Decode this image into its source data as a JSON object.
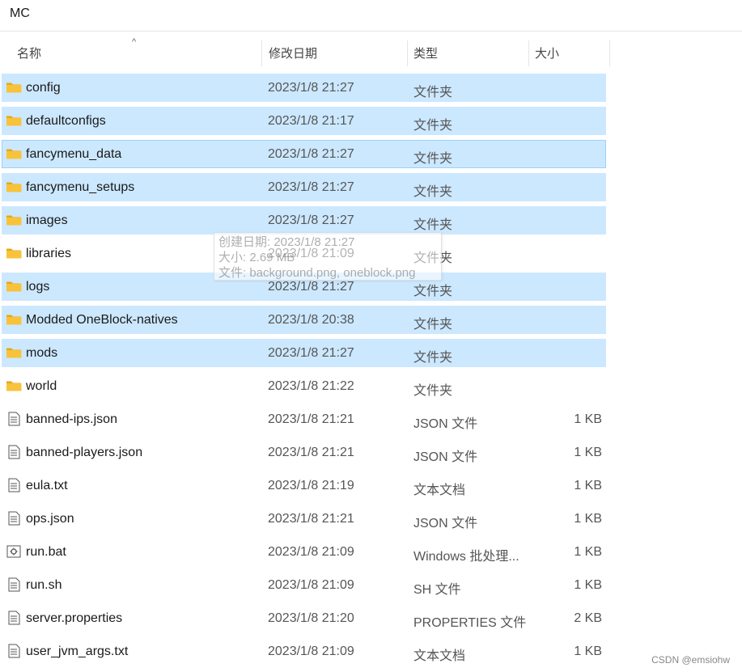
{
  "breadcrumb": {
    "title": "MC"
  },
  "columns": {
    "name": "名称",
    "date": "修改日期",
    "type": "类型",
    "size": "大小"
  },
  "rows": [
    {
      "name": "config",
      "date": "2023/1/8 21:27",
      "type": "文件夹",
      "size": "",
      "kind": "folder",
      "selected": true
    },
    {
      "name": "defaultconfigs",
      "date": "2023/1/8 21:17",
      "type": "文件夹",
      "size": "",
      "kind": "folder",
      "selected": true
    },
    {
      "name": "fancymenu_data",
      "date": "2023/1/8 21:27",
      "type": "文件夹",
      "size": "",
      "kind": "folder",
      "selected": true,
      "focused": true
    },
    {
      "name": "fancymenu_setups",
      "date": "2023/1/8 21:27",
      "type": "文件夹",
      "size": "",
      "kind": "folder",
      "selected": true
    },
    {
      "name": "images",
      "date": "2023/1/8 21:27",
      "type": "文件夹",
      "size": "",
      "kind": "folder",
      "selected": true
    },
    {
      "name": "libraries",
      "date": "2023/1/8 21:09",
      "type": "文件夹",
      "size": "",
      "kind": "folder",
      "selected": false
    },
    {
      "name": "logs",
      "date": "2023/1/8 21:27",
      "type": "文件夹",
      "size": "",
      "kind": "folder",
      "selected": true
    },
    {
      "name": "Modded OneBlock-natives",
      "date": "2023/1/8 20:38",
      "type": "文件夹",
      "size": "",
      "kind": "folder",
      "selected": true
    },
    {
      "name": "mods",
      "date": "2023/1/8 21:27",
      "type": "文件夹",
      "size": "",
      "kind": "folder",
      "selected": true
    },
    {
      "name": "world",
      "date": "2023/1/8 21:22",
      "type": "文件夹",
      "size": "",
      "kind": "folder",
      "selected": false
    },
    {
      "name": "banned-ips.json",
      "date": "2023/1/8 21:21",
      "type": "JSON 文件",
      "size": "1 KB",
      "kind": "file",
      "selected": false
    },
    {
      "name": "banned-players.json",
      "date": "2023/1/8 21:21",
      "type": "JSON 文件",
      "size": "1 KB",
      "kind": "file",
      "selected": false
    },
    {
      "name": "eula.txt",
      "date": "2023/1/8 21:19",
      "type": "文本文档",
      "size": "1 KB",
      "kind": "file",
      "selected": false
    },
    {
      "name": "ops.json",
      "date": "2023/1/8 21:21",
      "type": "JSON 文件",
      "size": "1 KB",
      "kind": "file",
      "selected": false
    },
    {
      "name": "run.bat",
      "date": "2023/1/8 21:09",
      "type": "Windows 批处理...",
      "size": "1 KB",
      "kind": "bat",
      "selected": false
    },
    {
      "name": "run.sh",
      "date": "2023/1/8 21:09",
      "type": "SH 文件",
      "size": "1 KB",
      "kind": "file",
      "selected": false
    },
    {
      "name": "server.properties",
      "date": "2023/1/8 21:20",
      "type": "PROPERTIES 文件",
      "size": "2 KB",
      "kind": "file",
      "selected": false
    },
    {
      "name": "user_jvm_args.txt",
      "date": "2023/1/8 21:09",
      "type": "文本文档",
      "size": "1 KB",
      "kind": "file",
      "selected": false
    }
  ],
  "tooltip": {
    "line1": "创建日期: 2023/1/8 21:27",
    "line2": "大小: 2.69 MB",
    "line3": "文件: background.png, oneblock.png"
  },
  "watermark": "CSDN @emsiohw",
  "colors": {
    "selection": "#cce8ff",
    "selection_border": "#99d1ff",
    "folder": "#f8c33a"
  }
}
